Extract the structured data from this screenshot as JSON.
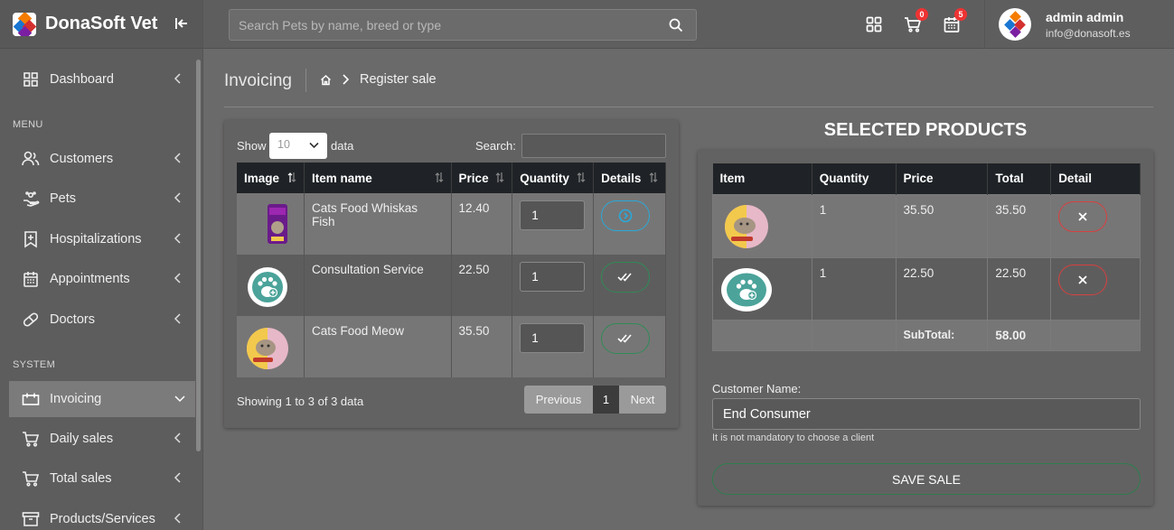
{
  "app": {
    "name": "DonaSoft Vet"
  },
  "search": {
    "placeholder": "Search Pets by name, breed or type"
  },
  "topbar": {
    "cart_badge": "0",
    "calendar_badge": "5"
  },
  "user": {
    "name": "admin admin",
    "email": "info@donasoft.es"
  },
  "sidebar": {
    "dashboard": "Dashboard",
    "section_menu": "MENU",
    "customers": "Customers",
    "pets": "Pets",
    "hospitalizations": "Hospitalizations",
    "appointments": "Appointments",
    "doctors": "Doctors",
    "section_system": "SYSTEM",
    "invoicing": "Invoicing",
    "daily_sales": "Daily sales",
    "total_sales": "Total sales",
    "products": "Products/Services"
  },
  "page": {
    "title": "Invoicing",
    "breadcrumb_current": "Register sale"
  },
  "products_table": {
    "show_label": "Show",
    "page_size": "10",
    "data_label": "data",
    "search_label": "Search:",
    "headers": {
      "image": "Image",
      "name": "Item name",
      "price": "Price",
      "quantity": "Quantity",
      "details": "Details"
    },
    "rows": [
      {
        "name": "Cats Food Whiskas Fish",
        "price": "12.40",
        "quantity": "1",
        "action_icon": "arrow-circle-icon"
      },
      {
        "name": "Consultation Service",
        "price": "22.50",
        "quantity": "1",
        "action_icon": "double-check-icon"
      },
      {
        "name": "Cats Food Meow",
        "price": "35.50",
        "quantity": "1",
        "action_icon": "double-check-icon"
      }
    ],
    "showing": "Showing 1 to 3 of 3 data",
    "pagination": {
      "previous": "Previous",
      "page": "1",
      "next": "Next"
    }
  },
  "selected": {
    "title": "SELECTED PRODUCTS",
    "headers": {
      "item": "Item",
      "quantity": "Quantity",
      "price": "Price",
      "total": "Total",
      "detail": "Detail"
    },
    "rows": [
      {
        "quantity": "1",
        "price": "35.50",
        "total": "35.50"
      },
      {
        "quantity": "1",
        "price": "22.50",
        "total": "22.50"
      }
    ],
    "subtotal_label": "SubTotal:",
    "subtotal": "58.00"
  },
  "customer": {
    "label": "Customer Name:",
    "value": "End Consumer",
    "hint": "It is not mandatory to choose a client"
  },
  "save_button": "SAVE SALE",
  "colors": {
    "accent_blue": "#2aa9d8",
    "accent_green": "#2e8b57",
    "danger": "#d84040",
    "badge": "#e33333"
  }
}
